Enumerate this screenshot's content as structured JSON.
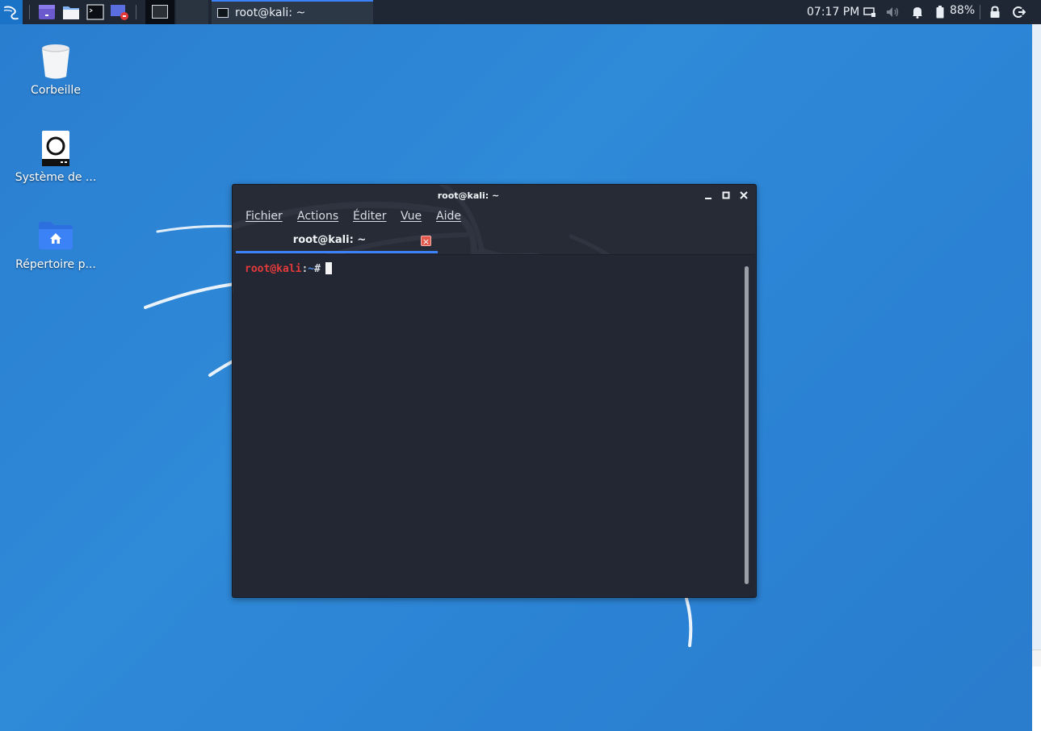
{
  "panel": {
    "task_title": "root@kali: ~",
    "clock": "07:17 PM",
    "battery_percent": "88%"
  },
  "desktop": {
    "icons": [
      {
        "label": "Corbeille",
        "icon": "trash-icon"
      },
      {
        "label": "Système de ...",
        "icon": "drive-icon"
      },
      {
        "label": "Répertoire p...",
        "icon": "home-folder-icon"
      }
    ]
  },
  "terminal": {
    "window_title": "root@kali: ~",
    "menu": [
      "Fichier",
      "Actions",
      "Éditer",
      "Vue",
      "Aide"
    ],
    "tab_label": "root@kali: ~",
    "prompt": {
      "user": "root@kali",
      "colon": ":",
      "path": "~",
      "symbol": "#"
    }
  },
  "colors": {
    "desktop_blue": "#2a7dd0",
    "panel_bg": "#1e2733",
    "terminal_bg": "#232733",
    "accent_blue": "#3b82f6",
    "prompt_red": "#e23a3a",
    "tab_close_red": "#e2584d"
  }
}
